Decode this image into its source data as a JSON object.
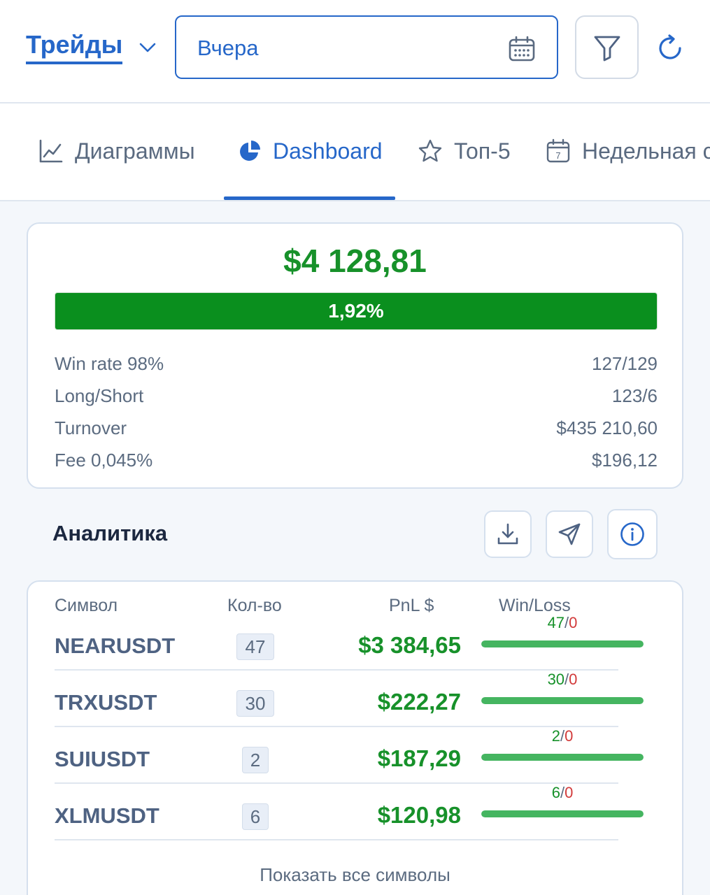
{
  "header": {
    "section_label": "Трейды",
    "date_value": "Вчера",
    "icons": [
      "chevron-down-icon",
      "calendar-icon",
      "filter-icon",
      "refresh-icon"
    ]
  },
  "tabs": [
    {
      "label": "Диаграммы",
      "icon": "line-chart-icon",
      "active": false
    },
    {
      "label": "Dashboard",
      "icon": "pie-chart-icon",
      "active": true
    },
    {
      "label": "Топ-5",
      "icon": "star-icon",
      "active": false
    },
    {
      "label": "Недельная с",
      "icon": "calendar-7-icon",
      "active": false
    }
  ],
  "summary": {
    "total_pnl": "$4 128,81",
    "percent_label": "1,92%",
    "progress_fill": 1.0,
    "rows": [
      {
        "label": "Win rate 98%",
        "value": "127/129"
      },
      {
        "label": "Long/Short",
        "value": "123/6"
      },
      {
        "label": "Turnover",
        "value": "$435 210,60"
      },
      {
        "label": "Fee 0,045%",
        "value": "$196,12"
      }
    ]
  },
  "analytics": {
    "title": "Аналитика",
    "action_icons": [
      "download-icon",
      "send-icon",
      "info-icon"
    ],
    "columns": {
      "symbol": "Символ",
      "qty": "Кол-во",
      "pnl": "PnL $",
      "winloss": "Win/Loss"
    },
    "rows": [
      {
        "symbol": "NEARUSDT",
        "qty": "47",
        "pnl": "$3 384,65",
        "wins": "47",
        "losses": "0",
        "win_fraction": 1.0
      },
      {
        "symbol": "TRXUSDT",
        "qty": "30",
        "pnl": "$222,27",
        "wins": "30",
        "losses": "0",
        "win_fraction": 1.0
      },
      {
        "symbol": "SUIUSDT",
        "qty": "2",
        "pnl": "$187,29",
        "wins": "2",
        "losses": "0",
        "win_fraction": 1.0
      },
      {
        "symbol": "XLMUSDT",
        "qty": "6",
        "pnl": "$120,98",
        "wins": "6",
        "losses": "0",
        "win_fraction": 1.0
      }
    ],
    "show_all_label": "Показать все символы"
  },
  "colors": {
    "accent": "#2667c9",
    "profit": "#17912a",
    "loss": "#d23a3a",
    "progress": "#0a8f1e",
    "winbar": "#45b560"
  }
}
